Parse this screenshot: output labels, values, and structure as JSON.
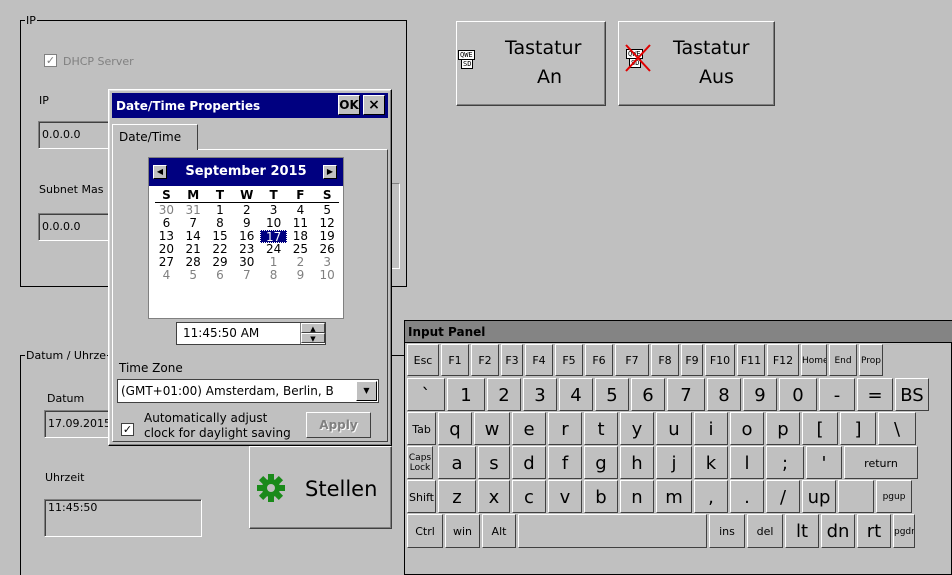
{
  "ip_group": {
    "legend": "IP",
    "dhcp_label": "DHCP Server",
    "ip_label": "IP",
    "ip_value": "0.0.0.0",
    "subnet_label": "Subnet Mas",
    "subnet_value": "0.0.0.0"
  },
  "datetime_group": {
    "legend": "Datum / Uhrze",
    "date_label": "Datum",
    "date_value": "17.09.2015",
    "time_label": "Uhrzeit",
    "time_value": "11:45:50"
  },
  "keyboard_on": {
    "icon_text_top": "QWE",
    "icon_text_bottom": "SD",
    "line1": "Tastatur",
    "line2": "An"
  },
  "keyboard_off": {
    "icon_text_top": "QWE",
    "icon_text_bottom": "SD",
    "line1": "Tastatur",
    "line2": "Aus"
  },
  "set_button": {
    "label": "Stellen"
  },
  "dialog": {
    "title": "Date/Time Properties",
    "ok_label": "OK",
    "close_label": "×",
    "tab_label": "Date/Time",
    "calendar": {
      "month_year": "September 2015",
      "weekdays": [
        "S",
        "M",
        "T",
        "W",
        "T",
        "F",
        "S"
      ],
      "weeks": [
        [
          "30",
          "31",
          "1",
          "2",
          "3",
          "4",
          "5"
        ],
        [
          "6",
          "7",
          "8",
          "9",
          "10",
          "11",
          "12"
        ],
        [
          "13",
          "14",
          "15",
          "16",
          "17",
          "18",
          "19"
        ],
        [
          "20",
          "21",
          "22",
          "23",
          "24",
          "25",
          "26"
        ],
        [
          "27",
          "28",
          "29",
          "30",
          "1",
          "2",
          "3"
        ],
        [
          "4",
          "5",
          "6",
          "7",
          "8",
          "9",
          "10"
        ]
      ],
      "selected_day": "17"
    },
    "time_value": "11:45:50 AM",
    "timezone_label": "Time Zone",
    "timezone_value": "(GMT+01:00) Amsterdam, Berlin, B",
    "dst_label_line1": "Automatically adjust",
    "dst_label_line2": "clock for daylight saving",
    "apply_label": "Apply"
  },
  "input_panel": {
    "title": "Input Panel",
    "rows": [
      [
        "Esc",
        "F1",
        "F2",
        "F3",
        "F4",
        "F5",
        "F6",
        "F7",
        "F8",
        "F9",
        "F10",
        "F11",
        "F12",
        "Home",
        "End",
        "Prop"
      ],
      [
        "`",
        "1",
        "2",
        "3",
        "4",
        "5",
        "6",
        "7",
        "8",
        "9",
        "0",
        "-",
        "=",
        "BS"
      ],
      [
        "Tab",
        "q",
        "w",
        "e",
        "r",
        "t",
        "y",
        "u",
        "i",
        "o",
        "p",
        "[",
        "]",
        "\\"
      ],
      [
        "Caps Lock",
        "a",
        "s",
        "d",
        "f",
        "g",
        "h",
        "j",
        "k",
        "l",
        ";",
        "'",
        "return"
      ],
      [
        "Shift",
        "z",
        "x",
        "c",
        "v",
        "b",
        "n",
        "m",
        ",",
        ".",
        "/",
        "up",
        "",
        "pgup"
      ],
      [
        "Ctrl",
        "win",
        "Alt",
        "",
        "ins",
        "del",
        "lt",
        "dn",
        "rt",
        "pgdn"
      ]
    ]
  }
}
